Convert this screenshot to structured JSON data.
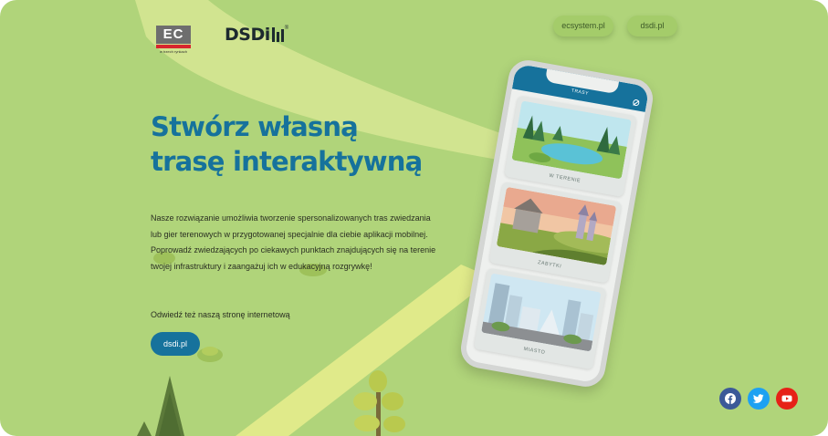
{
  "brand": {
    "ec_logo": "EC",
    "ec_logo_sub": "SYSTEM",
    "ec_tagline": "w trzech rynkach",
    "dsdi_logo": "DSDi"
  },
  "nav": {
    "ecsystem_label": "ecsystem.pl",
    "dsdi_label": "dsdi.pl"
  },
  "hero": {
    "headline_line1": "Stwórz własną",
    "headline_line2": "trasę interaktywną",
    "description": "Nasze rozwiązanie umożliwia tworzenie spersonalizowanych tras zwiedzania lub gier terenowych w przygotowanej specjalnie dla ciebie aplikacji mobilnej. Poprowadź zwiedzających po ciekawych punktach znajdujących się na terenie twojej infrastruktury i zaangażuj ich w edukacyjną rozgrywkę!",
    "visit_text": "Odwiedź też naszą stronę internetową",
    "cta_label": "dsdi.pl"
  },
  "phone": {
    "title": "TRASY",
    "cards": [
      {
        "label": "W TERENIE"
      },
      {
        "label": "ZABYTKI"
      },
      {
        "label": "MIASTO"
      }
    ]
  },
  "social": {
    "facebook_icon": "facebook-icon",
    "twitter_icon": "twitter-icon",
    "youtube_icon": "youtube-icon"
  },
  "colors": {
    "background": "#b0d47a",
    "accent_blue": "#16729c",
    "beam": "#dbe896",
    "facebook": "#3b5998",
    "twitter": "#1da1f2",
    "youtube": "#e62117"
  }
}
